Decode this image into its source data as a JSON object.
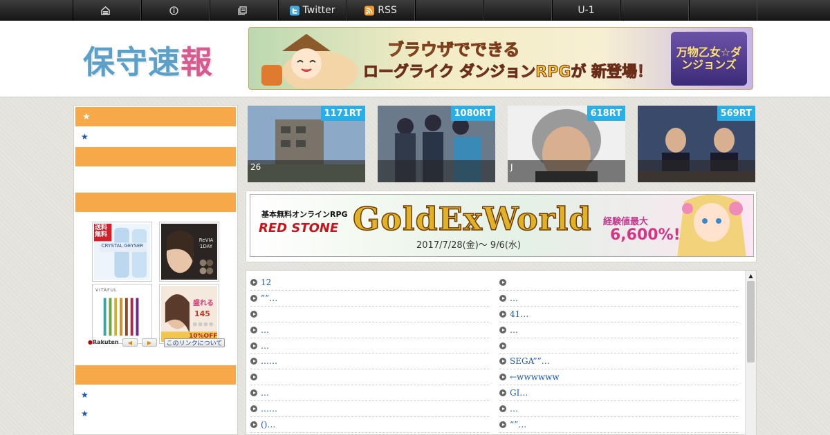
{
  "topnav": {
    "items": [
      {
        "icon": "home-icon",
        "label": ""
      },
      {
        "icon": "info-icon",
        "label": ""
      },
      {
        "icon": "archive-icon",
        "label": ""
      },
      {
        "icon": "twitter-icon",
        "label": "Twitter"
      },
      {
        "icon": "rss-icon",
        "label": "RSS"
      },
      {
        "icon": "",
        "label": ""
      },
      {
        "icon": "",
        "label": ""
      },
      {
        "icon": "",
        "label": "U-1"
      },
      {
        "icon": "",
        "label": ""
      },
      {
        "icon": "",
        "label": ""
      }
    ]
  },
  "header": {
    "logo_main": "保守速",
    "logo_accent": "報",
    "banner": {
      "line1": "ブラウザでできる",
      "line2_a": "ローグライク ダンジョンRPGが ",
      "line2_b": "新登場！",
      "game_title": "万物乙女☆ダンジョンズ"
    }
  },
  "sidebar": {
    "heads": [
      "★",
      "",
      "",
      ""
    ],
    "links": [
      "★",
      "★",
      "★"
    ],
    "ads": {
      "ad1_text": "送料無料",
      "ad1_sub": "CRYSTAL GEYSER",
      "ad2_text": "ReVIA 1DAY",
      "ad3_text": "VITAFUL",
      "ad4_text": "盛れる",
      "ad4_price": "145",
      "ad4_off": "10%OFF",
      "rakuten_label": "Rakuten",
      "prev_label": "◀",
      "next_label": "▶",
      "about_link": "このリンクについて"
    }
  },
  "trending": [
    {
      "rt": "1171RT",
      "caption": "26"
    },
    {
      "rt": "1080RT",
      "caption": ""
    },
    {
      "rt": "618RT",
      "caption": "J"
    },
    {
      "rt": "569RT",
      "caption": ""
    }
  ],
  "mid_banner": {
    "sub": "基本無料オンラインRPG",
    "logo": "RED STONE",
    "title": "GoldExWorld",
    "date": "2017/7/28(金)〜 9/6(水)",
    "exp_label": "経験値最大",
    "exp_value": "6,600%!"
  },
  "news": {
    "left": [
      "12",
      "””…",
      "",
      "…",
      "…",
      "……",
      "",
      "…",
      "……",
      "()…"
    ],
    "right": [
      "",
      "…",
      "41…",
      "…",
      "",
      "SEGA””…",
      "←wwwwww",
      "GI…",
      "…",
      "“”…"
    ]
  },
  "colors": {
    "accent_orange": "#f7a848",
    "rt_blue": "#29aee6",
    "link_blue": "#1a56b8"
  }
}
